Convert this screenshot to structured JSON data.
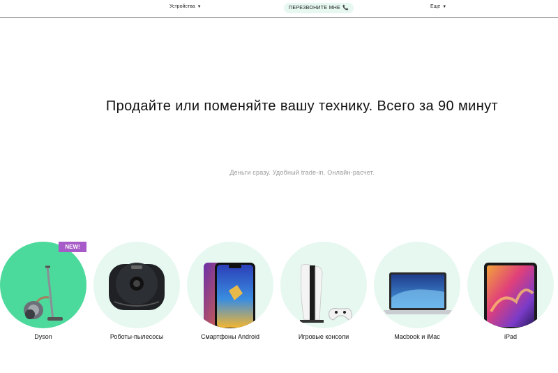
{
  "nav": {
    "devices_label": "Устройства",
    "callback_label": "ПЕРЕЗВОНИТЕ МНЕ",
    "more_label": "Еще"
  },
  "hero": {
    "headline": "Продайте или поменяйте вашу технику. Всего за 90 минут",
    "subline": "Деньги сразу. Удобный trade-in. Онлайн-расчет."
  },
  "categories": [
    {
      "label": "Dyson",
      "badge": "NEW!"
    },
    {
      "label": "Роботы-пылесосы"
    },
    {
      "label": "Смартфоны Android"
    },
    {
      "label": "Игровые консоли"
    },
    {
      "label": "Macbook и iMac"
    },
    {
      "label": "iPad"
    }
  ],
  "colors": {
    "circle_bg": "#e7f8f0",
    "dyson_bg": "#4cd99c",
    "badge_bg": "#a75bc8",
    "callback_bg": "#e6f8f0"
  },
  "icons": {
    "dropdown": "caret-down-icon",
    "phone": "phone-icon"
  }
}
